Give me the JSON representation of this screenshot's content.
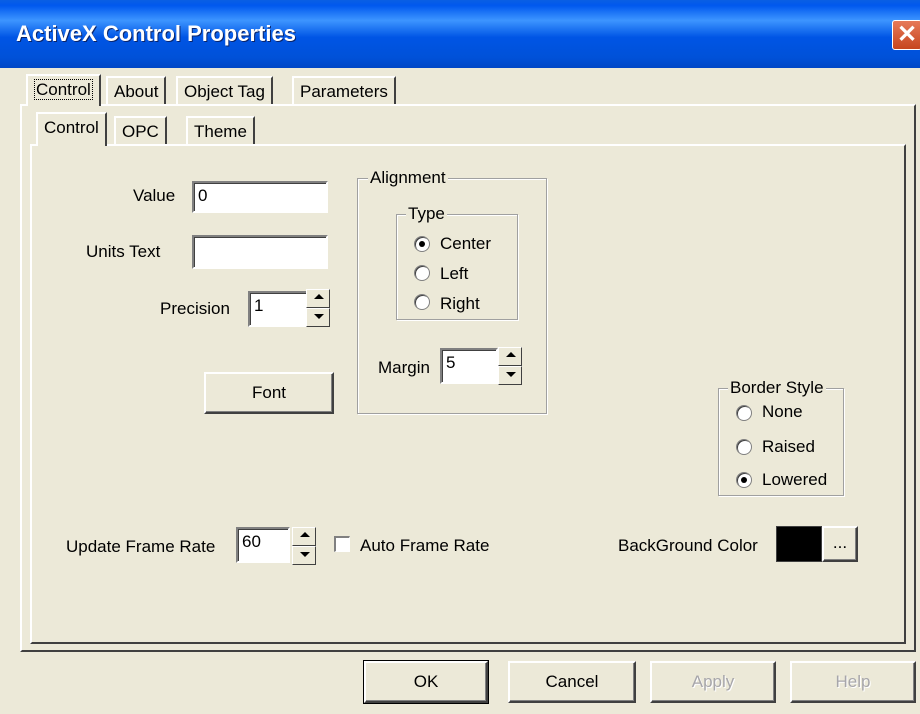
{
  "window": {
    "title": "ActiveX Control Properties"
  },
  "outer_tabs": [
    {
      "label": "Control",
      "selected": true
    },
    {
      "label": "About"
    },
    {
      "label": "Object Tag"
    },
    {
      "label": "Parameters"
    }
  ],
  "inner_tabs": [
    {
      "label": "Control",
      "selected": true
    },
    {
      "label": "OPC"
    },
    {
      "label": "Theme"
    }
  ],
  "form": {
    "value_label": "Value",
    "value": "0",
    "units_label": "Units Text",
    "units_value": "",
    "precision_label": "Precision",
    "precision_value": "1",
    "font_button": "Font",
    "update_rate_label": "Update Frame Rate",
    "update_rate_value": "60",
    "auto_frame_rate_label": "Auto Frame Rate",
    "auto_frame_rate_checked": false,
    "background_color_label": "BackGround Color",
    "background_color": "#000000",
    "ellipsis_button": "..."
  },
  "alignment": {
    "legend": "Alignment",
    "type_legend": "Type",
    "options": [
      {
        "label": "Center",
        "checked": true
      },
      {
        "label": "Left",
        "checked": false
      },
      {
        "label": "Right",
        "checked": false
      }
    ],
    "margin_label": "Margin",
    "margin_value": "5"
  },
  "border_style": {
    "legend": "Border Style",
    "options": [
      {
        "label": "None",
        "checked": false
      },
      {
        "label": "Raised",
        "checked": false
      },
      {
        "label": "Lowered",
        "checked": true
      }
    ]
  },
  "dialog_buttons": {
    "ok": "OK",
    "cancel": "Cancel",
    "apply": "Apply",
    "help": "Help"
  },
  "icons": {
    "close": "close-icon",
    "spin_up": "spin-up-icon",
    "spin_down": "spin-down-icon"
  }
}
